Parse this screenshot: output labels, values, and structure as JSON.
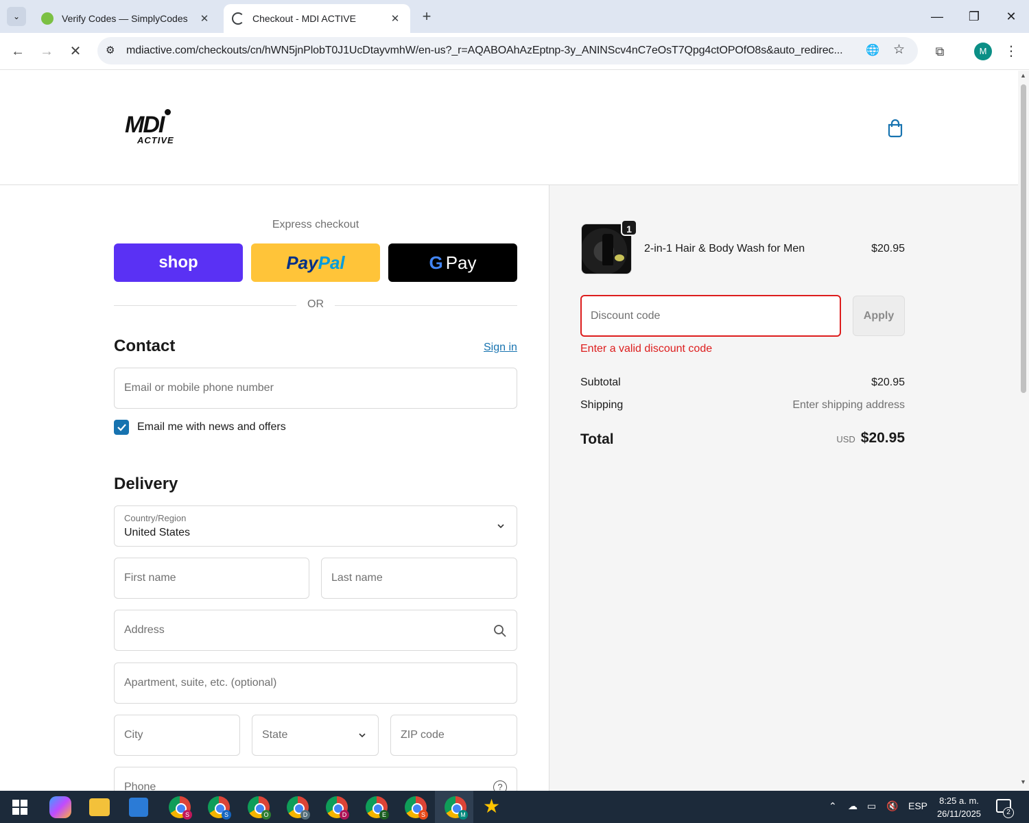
{
  "browser": {
    "tabs": [
      {
        "title": "Verify Codes — SimplyCodes",
        "active": false
      },
      {
        "title": "Checkout - MDI ACTIVE",
        "active": true
      }
    ],
    "url": "mdiactive.com/checkouts/cn/hWN5jnPlobT0J1UcDtayvmhW/en-us?_r=AQABOAhAzEptnp-3y_ANINScv4nC7eOsT7Qpg4ctOPOfO8s&auto_redirec...",
    "profile_initial": "M"
  },
  "header": {
    "logo_main": "MDI",
    "logo_sub": "ACTIVE"
  },
  "express": {
    "title": "Express checkout",
    "shop_label": "shop",
    "paypal_label_1": "Pay",
    "paypal_label_2": "Pal",
    "gpay_g": "G",
    "gpay_label": "Pay",
    "or": "OR"
  },
  "contact": {
    "title": "Contact",
    "sign_in": "Sign in",
    "email_placeholder": "Email or mobile phone number",
    "newsletter_label": "Email me with news and offers"
  },
  "delivery": {
    "title": "Delivery",
    "country_label": "Country/Region",
    "country_value": "United States",
    "first_name": "First name",
    "last_name": "Last name",
    "address": "Address",
    "apartment": "Apartment, suite, etc. (optional)",
    "city": "City",
    "state": "State",
    "zip": "ZIP code",
    "phone": "Phone"
  },
  "summary": {
    "quantity": "1",
    "product_name": "2-in-1 Hair & Body Wash for Men",
    "product_price": "$20.95",
    "discount_placeholder": "Discount code",
    "apply_label": "Apply",
    "discount_error": "Enter a valid discount code",
    "subtotal_label": "Subtotal",
    "subtotal_value": "$20.95",
    "shipping_label": "Shipping",
    "shipping_value": "Enter shipping address",
    "total_label": "Total",
    "total_currency": "USD",
    "total_value": "$20.95"
  },
  "taskbar": {
    "badges": [
      "S",
      "S",
      "O",
      "D",
      "D",
      "E",
      "S",
      "M"
    ],
    "language": "ESP",
    "time": "8:25 a. m.",
    "date": "26/11/2025",
    "notifications": "2"
  },
  "colors": {
    "accent": "#1773b0",
    "error": "#dd1d1d",
    "shop_pay": "#5a31f4",
    "paypal": "#ffc439"
  }
}
